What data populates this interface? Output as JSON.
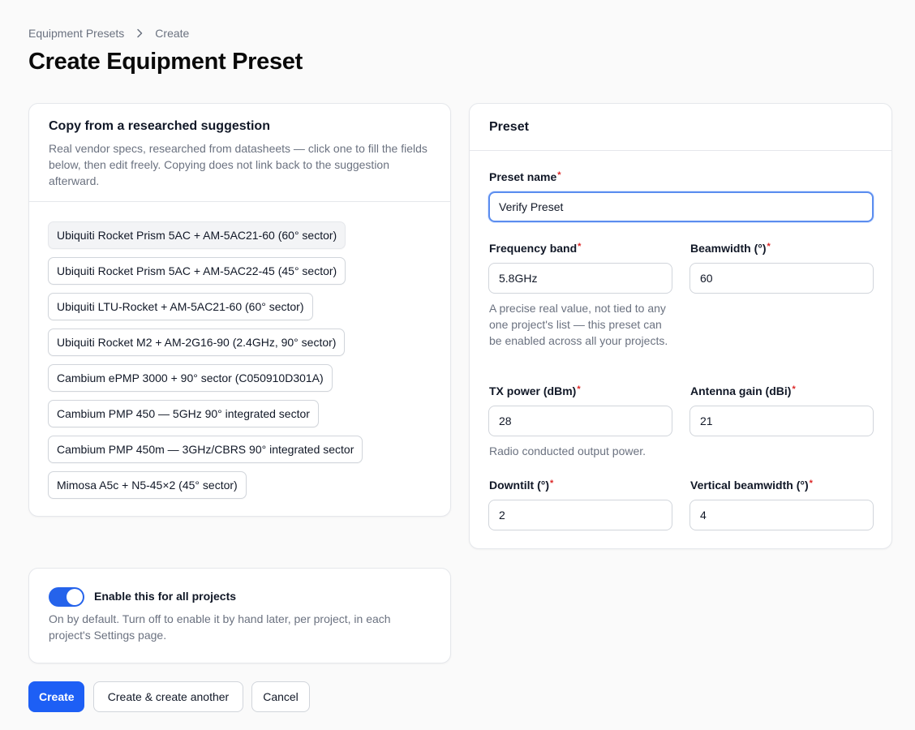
{
  "breadcrumb": {
    "parent": "Equipment Presets",
    "current": "Create"
  },
  "page_title": "Create Equipment Preset",
  "suggestions": {
    "title": "Copy from a researched suggestion",
    "description": "Real vendor specs, researched from datasheets — click one to fill the fields below, then edit freely. Copying does not link back to the suggestion afterward.",
    "items": [
      "Ubiquiti Rocket Prism 5AC + AM-5AC21-60 (60° sector)",
      "Ubiquiti Rocket Prism 5AC + AM-5AC22-45 (45° sector)",
      "Ubiquiti LTU-Rocket + AM-5AC21-60 (60° sector)",
      "Ubiquiti Rocket M2 + AM-2G16-90 (2.4GHz, 90° sector)",
      "Cambium ePMP 3000 + 90° sector (C050910D301A)",
      "Cambium PMP 450 — 5GHz 90° integrated sector",
      "Cambium PMP 450m — 3GHz/CBRS 90° integrated sector",
      "Mimosa A5c + N5-45×2 (45° sector)"
    ]
  },
  "preset": {
    "title": "Preset",
    "required_mark": "*",
    "name_label": "Preset name",
    "name_value": "Verify Preset",
    "frequency_label": "Frequency band",
    "frequency_value": "5.8GHz",
    "frequency_help": "A precise real value, not tied to any one project's list — this preset can be enabled across all your projects.",
    "beamwidth_label": "Beamwidth (°)",
    "beamwidth_value": "60",
    "tx_label": "TX power (dBm)",
    "tx_value": "28",
    "tx_help": "Radio conducted output power.",
    "gain_label": "Antenna gain (dBi)",
    "gain_value": "21",
    "downtilt_label": "Downtilt (°)",
    "downtilt_value": "2",
    "vbeam_label": "Vertical beamwidth (°)",
    "vbeam_value": "4"
  },
  "enable": {
    "label": "Enable this for all projects",
    "checked": true,
    "help": "On by default. Turn off to enable it by hand later, per project, in each project's Settings page."
  },
  "actions": {
    "create": "Create",
    "create_another": "Create & create another",
    "cancel": "Cancel"
  },
  "colors": {
    "primary": "#1d5ff5",
    "required": "#dc2626",
    "focus_border": "#5b8def"
  },
  "icons": {
    "breadcrumb_separator": "chevron-right-icon"
  }
}
